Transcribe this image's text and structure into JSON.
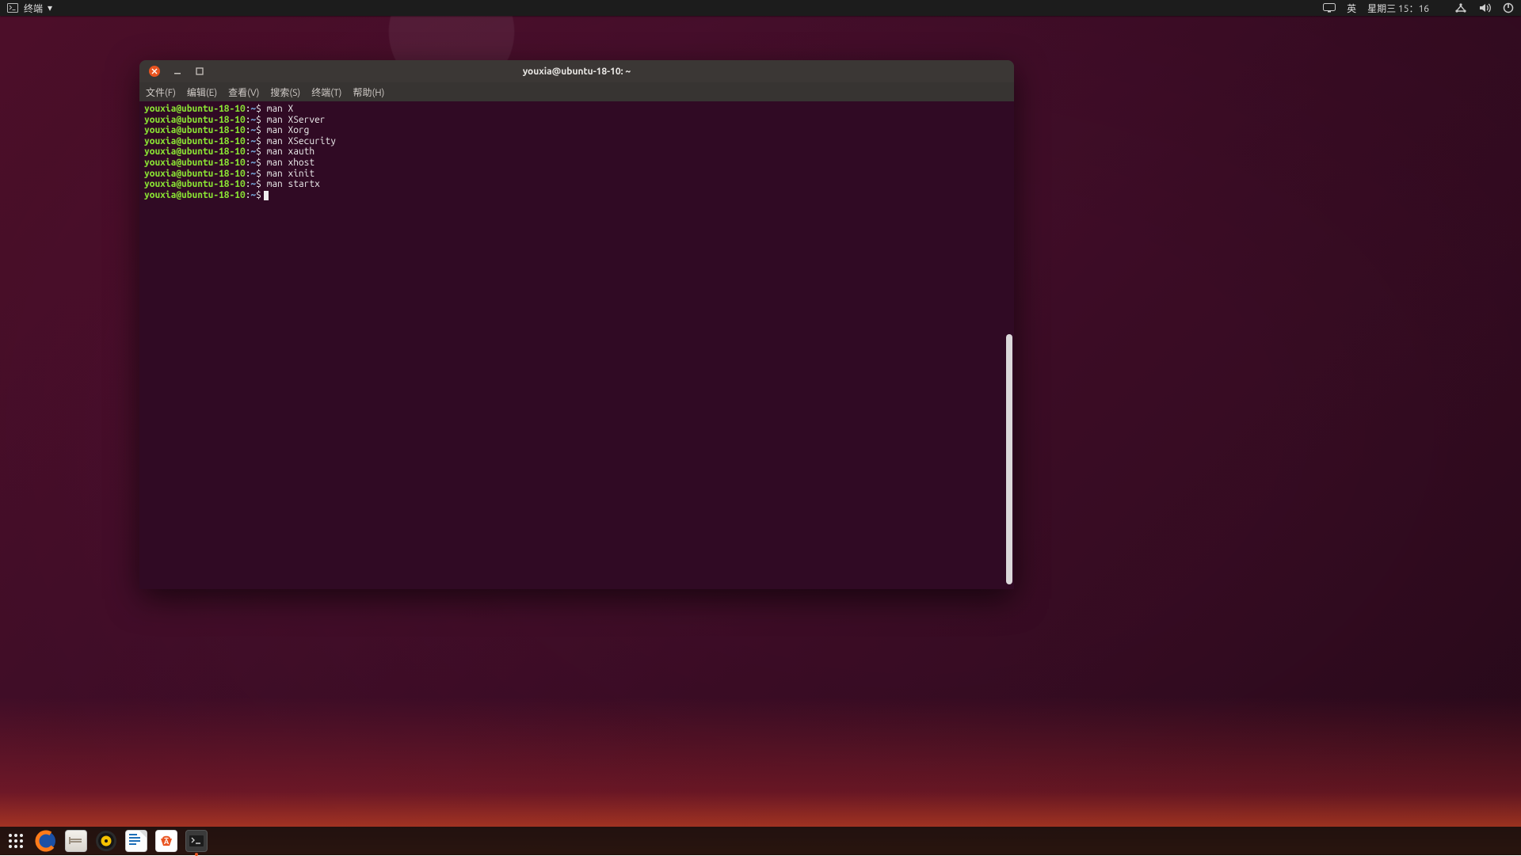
{
  "topbar": {
    "app_indicator_label": "终端",
    "ime_label": "英",
    "datetime": "星期三 15：16"
  },
  "terminal": {
    "title": "youxia@ubuntu-18-10: ~",
    "menu": [
      "文件(F)",
      "编辑(E)",
      "查看(V)",
      "搜索(S)",
      "终端(T)",
      "帮助(H)"
    ],
    "prompt": {
      "user_host": "youxia@ubuntu-18-10",
      "sep": ":",
      "path": "~",
      "symbol": "$"
    },
    "commands": [
      "man X",
      "man XServer",
      "man Xorg",
      "man XSecurity",
      "man xauth",
      "man xhost",
      "man xinit",
      "man startx"
    ]
  },
  "dock": {
    "apps": [
      "show-applications",
      "firefox",
      "files",
      "rhythmbox",
      "libreoffice-writer",
      "software",
      "terminal"
    ]
  }
}
